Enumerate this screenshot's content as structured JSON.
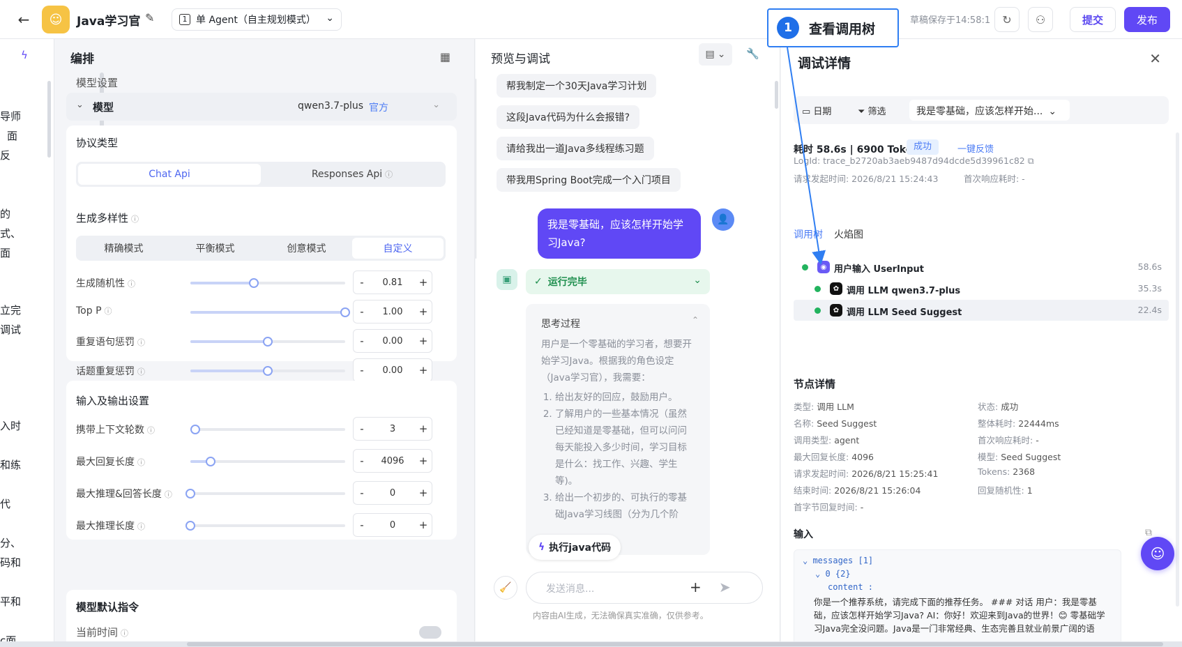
{
  "topbar": {
    "app_name": "Java学习官",
    "mode_num": "1",
    "mode_label": "单 Agent（自主规划模式）",
    "saved_text": "草稿保存于14:58:1",
    "submit_label": "提交",
    "publish_label": "发布"
  },
  "left_strip": {
    "fragments": [
      "导师",
      "面",
      "反",
      "的",
      "式、",
      "面",
      "立完",
      "调试",
      "入时",
      "和练",
      "代",
      "分、",
      "码和",
      "平和",
      "c面"
    ]
  },
  "orchestrate": {
    "title": "编排",
    "model_settings_label": "模型设置",
    "model_label": "模型",
    "model_value": "qwen3.7-plus",
    "model_tag": "官方",
    "protocol_label": "协议类型",
    "protocol_options": [
      "Chat Api",
      "Responses Api"
    ],
    "protocol_active": "Chat Api",
    "diversity_label": "生成多样性",
    "diversity_modes": [
      "精确模式",
      "平衡模式",
      "创意模式",
      "自定义"
    ],
    "diversity_active": "自定义",
    "params": [
      {
        "label": "生成随机性",
        "value": "0.81",
        "level": 0.41
      },
      {
        "label": "Top P",
        "value": "1.00",
        "level": 1.0
      },
      {
        "label": "重复语句惩罚",
        "value": "0.00",
        "level": 0.5
      },
      {
        "label": "话题重复惩罚",
        "value": "0.00",
        "level": 0.5
      }
    ],
    "io_label": "输入及输出设置",
    "io_params": [
      {
        "label": "携带上下文轮数",
        "value": "3",
        "level": 0.03
      },
      {
        "label": "最大回复长度",
        "value": "4096",
        "level": 0.13
      },
      {
        "label": "最大推理&回答长度",
        "value": "0",
        "level": 0.0
      },
      {
        "label": "最大推理长度",
        "value": "0",
        "level": 0.0
      }
    ],
    "default_instr_label": "模型默认指令",
    "current_time_label": "当前时间"
  },
  "chat": {
    "title": "预览与调试",
    "suggestions": [
      "帮我制定一个30天Java学习计划",
      "这段Java代码为什么会报错?",
      "请给我出一道Java多线程练习题",
      "带我用Spring Boot完成一个入门项目"
    ],
    "user_message": "我是零基础，应该怎样开始学习Java?",
    "run_status": "运行完毕",
    "think_title": "思考过程",
    "think_intro": "用户是一个零基础的学习者，想要开始学习Java。根据我的角色设定（Java学习官），我需要：",
    "think_steps": [
      "给出友好的回应，鼓励用户。",
      "了解用户的一些基本情况（虽然已经知道是零基础，但可以问问每天能投入多少时间，学习目标是什么：找工作、兴趣、学生等)。",
      "给出一个初步的、可执行的零基础Java学习线图（分为几个阶"
    ],
    "exec_button": "执行java代码",
    "input_placeholder": "发送消息...",
    "disclaimer": "内容由AI生成，无法确保真实准确，仅供参考。"
  },
  "debug": {
    "title": "调试详情",
    "filter_date": "日期",
    "filter_label": "筛选",
    "filter_select": "我是零基础，应该怎样开始...",
    "stat_text": "耗时 58.6s  |  6900 Tokens",
    "status_tag": "成功",
    "feedback": "一键反馈",
    "log_id": "LogId:  trace_b2720ab3aeb9487d94dcde5d39961c82",
    "request_time": "请求发起时间:  2026/8/21 15:24:43",
    "first_response": "首次响应耗时:  -",
    "tabs": [
      "调用树",
      "火焰图"
    ],
    "tree": [
      {
        "name": "用户输入 UserInput",
        "time": "58.6s"
      },
      {
        "name": "调用 LLM qwen3.7-plus",
        "time": "35.3s"
      },
      {
        "name": "调用 LLM Seed Suggest",
        "time": "22.4s"
      }
    ],
    "node_title": "节点详情",
    "node_left": [
      {
        "k": "类型:",
        "v": "调用 LLM"
      },
      {
        "k": "名称:",
        "v": "Seed Suggest"
      },
      {
        "k": "调用类型:",
        "v": "agent"
      },
      {
        "k": "最大回复长度:",
        "v": "4096"
      },
      {
        "k": "请求发起时间:",
        "v": "2026/8/21 15:25:41"
      },
      {
        "k": "结束时间:",
        "v": "2026/8/21 15:26:04"
      },
      {
        "k": "首字节回复时间:",
        "v": "-"
      }
    ],
    "node_right": [
      {
        "k": "状态:",
        "v": "成功"
      },
      {
        "k": "整体耗时:",
        "v": "22444ms"
      },
      {
        "k": "首次响应耗时:",
        "v": "-"
      },
      {
        "k": "模型:",
        "v": "Seed Suggest"
      },
      {
        "k": "Tokens:",
        "v": "2368"
      },
      {
        "k": "回复随机性:",
        "v": "1"
      }
    ],
    "input_title": "输入",
    "code_messages": "messages [1]",
    "code_index": "0 {2}",
    "code_content_key": "content :",
    "code_content_text": "你是一个推荐系统，请完成下面的推荐任务。 ### 对话 用户：我是零基础，应该怎样开始学习Java? AI：你好！欢迎来到Java的世界！😊 零基础学习Java完全没问题。Java是一门非常经典、生态完善且就业前景广阔的语"
  },
  "callout": {
    "number": "1",
    "text": "查看调用树"
  },
  "colors": {
    "accent": "#6048f5",
    "link": "#4d7df5",
    "success": "#22b35e",
    "callout_border": "#2f7ef2"
  }
}
